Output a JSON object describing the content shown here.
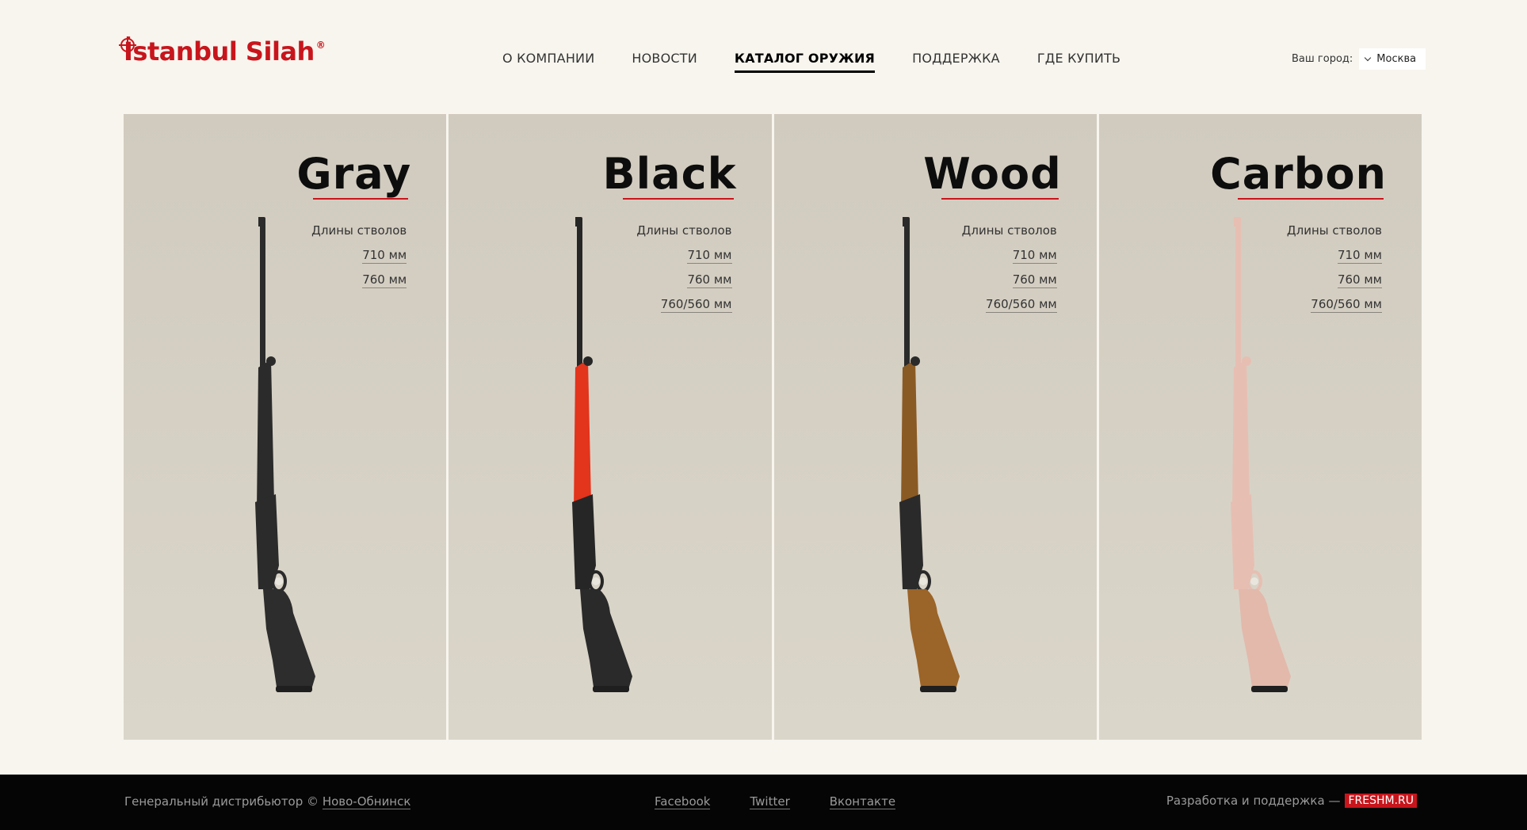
{
  "header": {
    "logo": "İstanbul Silah",
    "logo_reg": "®",
    "nav": [
      {
        "label": "О КОМПАНИИ"
      },
      {
        "label": "НОВОСТИ"
      },
      {
        "label": "КАТАЛОГ ОРУЖИЯ",
        "active": true
      },
      {
        "label": "ПОДДЕРЖКА"
      },
      {
        "label": "ГДЕ КУПИТЬ"
      }
    ],
    "city_label": "Ваш город:",
    "city_value": "Москва"
  },
  "catalog": {
    "lengths_label": "Длины стволов",
    "panels": [
      {
        "title": "Gray",
        "lengths": [
          "710 мм",
          "760 мм"
        ],
        "palette": {
          "body": "#2b2b2b",
          "accent": "#2b2b2b",
          "stock": "#2d2d2d"
        }
      },
      {
        "title": "Black",
        "lengths": [
          "710 мм",
          "760 мм",
          "760/560 мм"
        ],
        "palette": {
          "body": "#262626",
          "accent": "#e3341c",
          "stock": "#2a2a2a"
        }
      },
      {
        "title": "Wood",
        "lengths": [
          "710 мм",
          "760 мм",
          "760/560 мм"
        ],
        "palette": {
          "body": "#2a2a2a",
          "accent": "#8a5a24",
          "stock": "#9b6428"
        }
      },
      {
        "title": "Carbon",
        "lengths": [
          "710 мм",
          "760 мм",
          "760/560 мм"
        ],
        "palette": {
          "body": "#e6bfb2",
          "accent": "#e6bfb2",
          "stock": "#e2b9ab"
        }
      }
    ]
  },
  "footer": {
    "distributor_text": "Генеральный дистрибьютор ©",
    "distributor_link": "Ново-Обнинск",
    "social": [
      "Facebook",
      "Twitter",
      "Вконтакте"
    ],
    "dev_text": "Разработка и поддержка —",
    "dev_badge": "FRESHM.RU"
  }
}
